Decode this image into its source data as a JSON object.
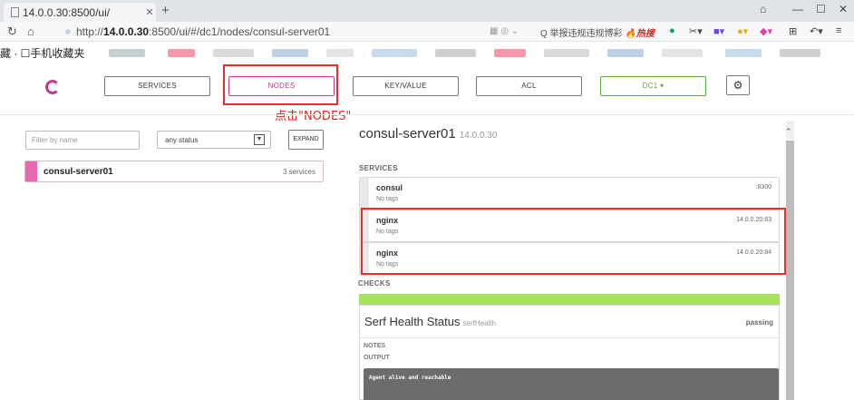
{
  "browser": {
    "tab_title": "14.0.0.30:8500/ui/",
    "url_host": "14.0.0.30",
    "url_prefix": "http://",
    "url_rest": ":8500/ui/#/dc1/nodes/consul-server01",
    "search_placeholder": "Q 举报违规违规博彩",
    "search_hot": "🔥热搜",
    "bookmarks_text": "藏 · ☐手机收藏夹"
  },
  "nav": {
    "services": "SERVICES",
    "nodes": "NODES",
    "keyvalue": "KEY/VALUE",
    "acl": "ACL",
    "dc": "DC1 ▾"
  },
  "annotation": "点击\"NODES\"",
  "filter": {
    "placeholder": "Filter by name",
    "status": "any status",
    "expand": "EXPAND"
  },
  "nodes": [
    {
      "name": "consul-server01",
      "count": "3 services"
    }
  ],
  "detail": {
    "name": "consul-server01",
    "ip": "14.0.0.30",
    "services_label": "SERVICES",
    "services": [
      {
        "name": "consul",
        "tags": "No tags",
        "addr": ":8300"
      },
      {
        "name": "nginx",
        "tags": "No tags",
        "addr": "14.0.0.20:83"
      },
      {
        "name": "nginx",
        "tags": "No tags",
        "addr": "14.0.0.20:84"
      }
    ],
    "checks_label": "CHECKS",
    "check": {
      "title": "Serf Health Status",
      "id": "serfHealth",
      "status": "passing",
      "notes_label": "NOTES",
      "output_label": "OUTPUT",
      "output": "Agent alive and reachable"
    }
  },
  "colors": {
    "brand": "#c03c8a",
    "dc": "#5aaa3c",
    "passing": "#a7e05a",
    "annotation": "#e02020"
  }
}
